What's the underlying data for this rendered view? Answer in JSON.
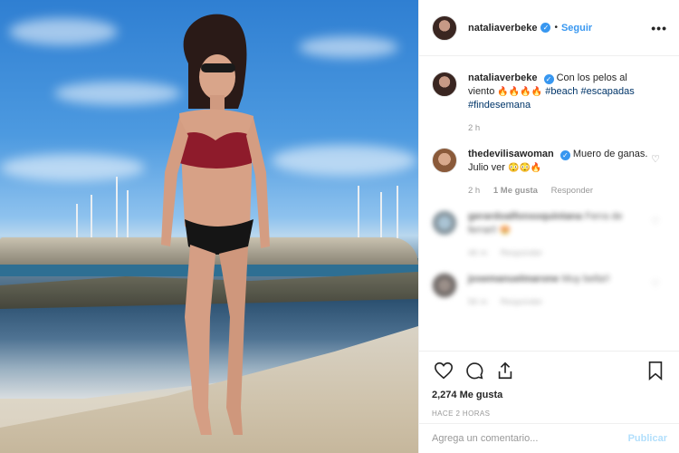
{
  "header": {
    "username": "nataliaverbeke",
    "dot": "•",
    "follow_label": "Seguir",
    "more": "•••"
  },
  "caption": {
    "username": "nataliaverbeke",
    "text_start": "Con los pelos al viento",
    "emojis": "🔥🔥🔥🔥",
    "tags": [
      "#beach",
      "#escapadas",
      "#findesemana"
    ],
    "time": "2 h"
  },
  "comments": [
    {
      "username": "thedevilisawoman",
      "text": "Muero de ganas. Julio ver",
      "emojis": "😳😳🔥",
      "time": "2 h",
      "likes": "1 Me gusta",
      "reply": "Responder"
    },
    {
      "username": "gerardoalfonsoquintana",
      "text": "Ferra de ferrari!",
      "emojis": "😍",
      "time": "46 m",
      "reply": "Responder"
    },
    {
      "username": "josemanuelmarone",
      "text": "Muy bella!!",
      "time": "56 m",
      "reply": "Responder"
    }
  ],
  "actions": {
    "likes": "2,274 Me gusta",
    "ago": "HACE 2 HORAS"
  },
  "add_comment": {
    "placeholder": "Agrega un comentario...",
    "publish": "Publicar"
  },
  "colors": {
    "link": "#3897f0",
    "hashtag": "#003569",
    "verified": "#3897f0"
  },
  "icons": [
    "heart-icon",
    "comment-icon",
    "share-icon",
    "bookmark-icon",
    "more-icon",
    "verified-icon"
  ]
}
